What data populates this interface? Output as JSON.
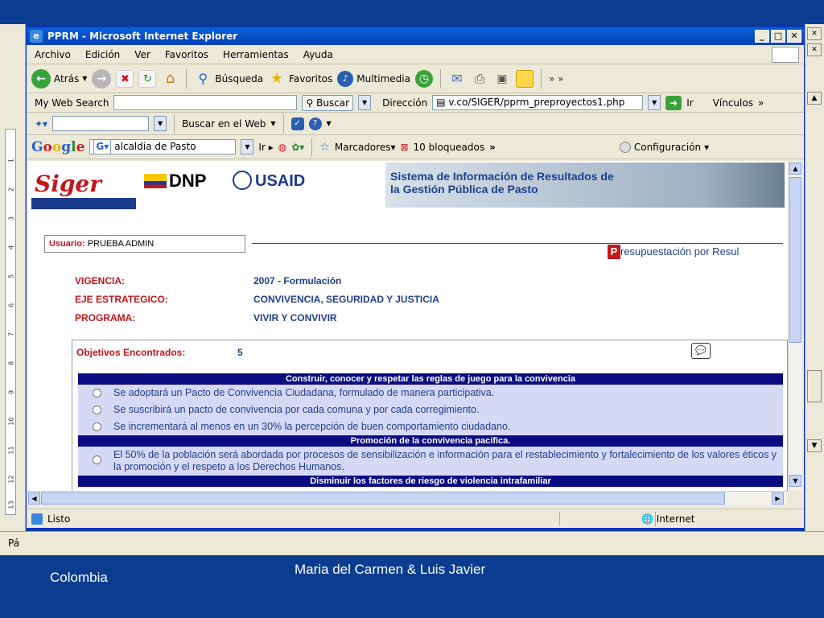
{
  "word": {
    "ruler_numbers": [
      "1",
      "2",
      "3",
      "4",
      "5",
      "6",
      "7",
      "8",
      "9",
      "10",
      "11",
      "12",
      "13"
    ],
    "status_left": "Pá"
  },
  "ie": {
    "title": "PPRM - Microsoft Internet Explorer",
    "menu": [
      "Archivo",
      "Edición",
      "Ver",
      "Favoritos",
      "Herramientas",
      "Ayuda"
    ],
    "toolbar": {
      "back": "Atrás",
      "search": "Búsqueda",
      "favorites": "Favoritos",
      "multimedia": "Multimedia"
    },
    "address": {
      "my_web_search_label": "My Web Search",
      "buscar_btn": "Buscar",
      "direccion_label": "Dirección",
      "url": "v.co/SIGER/pprm_preproyectos1.php",
      "go_label": "Ir",
      "links_label": "Vínculos"
    },
    "row3": {
      "buscar_en_web": "Buscar en el Web"
    },
    "google": {
      "logo": "Google",
      "query": "alcaldia de Pasto",
      "ir": "Ir",
      "marcadores": "Marcadores",
      "bloqueados": "10 bloqueados",
      "configuracion": "Configuración"
    },
    "status": {
      "left": "Listo",
      "zone": "Internet"
    }
  },
  "page": {
    "siger": "Siger",
    "dnp": "DNP",
    "usaid": "USAID",
    "system_title_1": "Sistema de Información de Resultados de",
    "system_title_2": "la Gestión Pública de Pasto",
    "user_label": "Usuario:",
    "user_value": "PRUEBA ADMIN",
    "presup_initial": "P",
    "presup_rest": "resupuestación por Resul",
    "vigencia_label": "VIGENCIA:",
    "vigencia_value": "2007 - Formulación",
    "eje_label": "EJE ESTRATEGICO:",
    "eje_value": "CONVIVENCIA, SEGURIDAD Y JUSTICIA",
    "programa_label": "PROGRAMA:",
    "programa_value": "VIVIR Y CONVIVIR",
    "objetivos_label": "Objetivos Encontrados:",
    "objetivos_count": "5",
    "groups": [
      {
        "header": "Construir, conocer y respetar las reglas de juego para la convivencia",
        "items": [
          "Se adoptará un Pacto de Convivencia Ciudadana, formulado de manera participativa.",
          "Se suscribirá un pacto de convivencia por cada comuna y por cada corregimiento.",
          "Se incrementará al menos en un 30% la percepción de buen comportamiento ciudadano."
        ]
      },
      {
        "header": "Promoción de la convivencia pacífica.",
        "items": [
          "El 50% de la población será abordada por procesos de sensibilización e información para el restablecimiento y fortalecimiento de los valores éticos y la promoción y el respeto a los Derechos Humanos."
        ]
      },
      {
        "header": "Disminuir los factores de riesgo de violencia intrafamiliar",
        "items": []
      }
    ]
  },
  "slide": {
    "footer_left": "Colombia",
    "footer_center": "Maria del Carmen & Luis Javier"
  }
}
